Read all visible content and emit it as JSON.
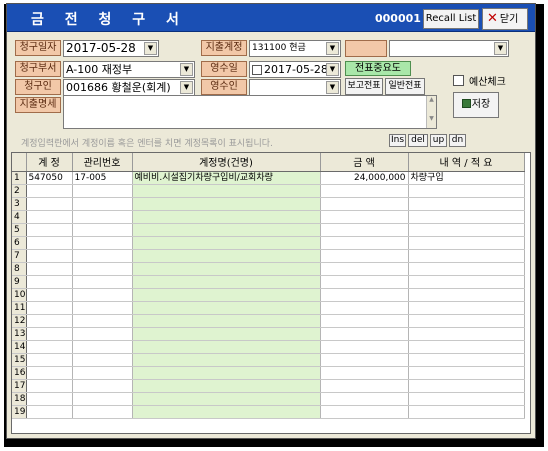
{
  "window": {
    "title": "금 전 청 구 서",
    "doc_number": "000001",
    "recall_label": "Recall List",
    "close_label": "닫기"
  },
  "form": {
    "request_date_label": "청구일자",
    "request_date_value": "2017-05-28",
    "dept_label": "청구부서",
    "dept_value": "A-100  재정부",
    "requester_label": "청구인",
    "requester_value": "001686 황철운(회계)",
    "expense_account_label": "지출계정",
    "expense_account_value": "131100 현금",
    "receipt_date_label": "영수일",
    "receipt_date_value": "2017-05-28",
    "receiver_label": "영수인",
    "receiver_value": "",
    "memo_label": "지출명세",
    "memo_value": "",
    "voucher_priority_label": "전표중요도",
    "report_voucher_label": "보고전표",
    "general_voucher_label": "일반전표",
    "budget_check_label": "예산체크",
    "save_label": "저장",
    "hint_text": "계정입력란에서 계정이름 혹은 엔터를 치면 계정목록이 표시됩니다.",
    "ins_label": "Ins",
    "del_label": "del",
    "up_label": "up",
    "dn_label": "dn"
  },
  "grid": {
    "columns": [
      "계 정",
      "관리번호",
      "계정명(건명)",
      "금   액",
      "내 역 / 적 요"
    ],
    "rows": [
      {
        "num": "1",
        "account": "547050",
        "mgmt_no": "17-005",
        "account_name": "예비비.시설집기차량구입비/교회차량",
        "amount": "24,000,000",
        "memo": "차량구입"
      },
      {
        "num": "2",
        "account": "",
        "mgmt_no": "",
        "account_name": "",
        "amount": "",
        "memo": ""
      },
      {
        "num": "3",
        "account": "",
        "mgmt_no": "",
        "account_name": "",
        "amount": "",
        "memo": ""
      },
      {
        "num": "4",
        "account": "",
        "mgmt_no": "",
        "account_name": "",
        "amount": "",
        "memo": ""
      },
      {
        "num": "5",
        "account": "",
        "mgmt_no": "",
        "account_name": "",
        "amount": "",
        "memo": ""
      },
      {
        "num": "6",
        "account": "",
        "mgmt_no": "",
        "account_name": "",
        "amount": "",
        "memo": ""
      },
      {
        "num": "7",
        "account": "",
        "mgmt_no": "",
        "account_name": "",
        "amount": "",
        "memo": ""
      },
      {
        "num": "8",
        "account": "",
        "mgmt_no": "",
        "account_name": "",
        "amount": "",
        "memo": ""
      },
      {
        "num": "9",
        "account": "",
        "mgmt_no": "",
        "account_name": "",
        "amount": "",
        "memo": ""
      },
      {
        "num": "10",
        "account": "",
        "mgmt_no": "",
        "account_name": "",
        "amount": "",
        "memo": ""
      },
      {
        "num": "11",
        "account": "",
        "mgmt_no": "",
        "account_name": "",
        "amount": "",
        "memo": ""
      },
      {
        "num": "12",
        "account": "",
        "mgmt_no": "",
        "account_name": "",
        "amount": "",
        "memo": ""
      },
      {
        "num": "13",
        "account": "",
        "mgmt_no": "",
        "account_name": "",
        "amount": "",
        "memo": ""
      },
      {
        "num": "14",
        "account": "",
        "mgmt_no": "",
        "account_name": "",
        "amount": "",
        "memo": ""
      },
      {
        "num": "15",
        "account": "",
        "mgmt_no": "",
        "account_name": "",
        "amount": "",
        "memo": ""
      },
      {
        "num": "16",
        "account": "",
        "mgmt_no": "",
        "account_name": "",
        "amount": "",
        "memo": ""
      },
      {
        "num": "17",
        "account": "",
        "mgmt_no": "",
        "account_name": "",
        "amount": "",
        "memo": ""
      },
      {
        "num": "18",
        "account": "",
        "mgmt_no": "",
        "account_name": "",
        "amount": "",
        "memo": ""
      },
      {
        "num": "19",
        "account": "",
        "mgmt_no": "",
        "account_name": "",
        "amount": "",
        "memo": ""
      }
    ]
  },
  "colors": {
    "titlebar": "#1a4fb4",
    "label_bg": "#f2c8a8",
    "green_button": "#a9e7a9",
    "account_name_column": "#dff3d0"
  }
}
